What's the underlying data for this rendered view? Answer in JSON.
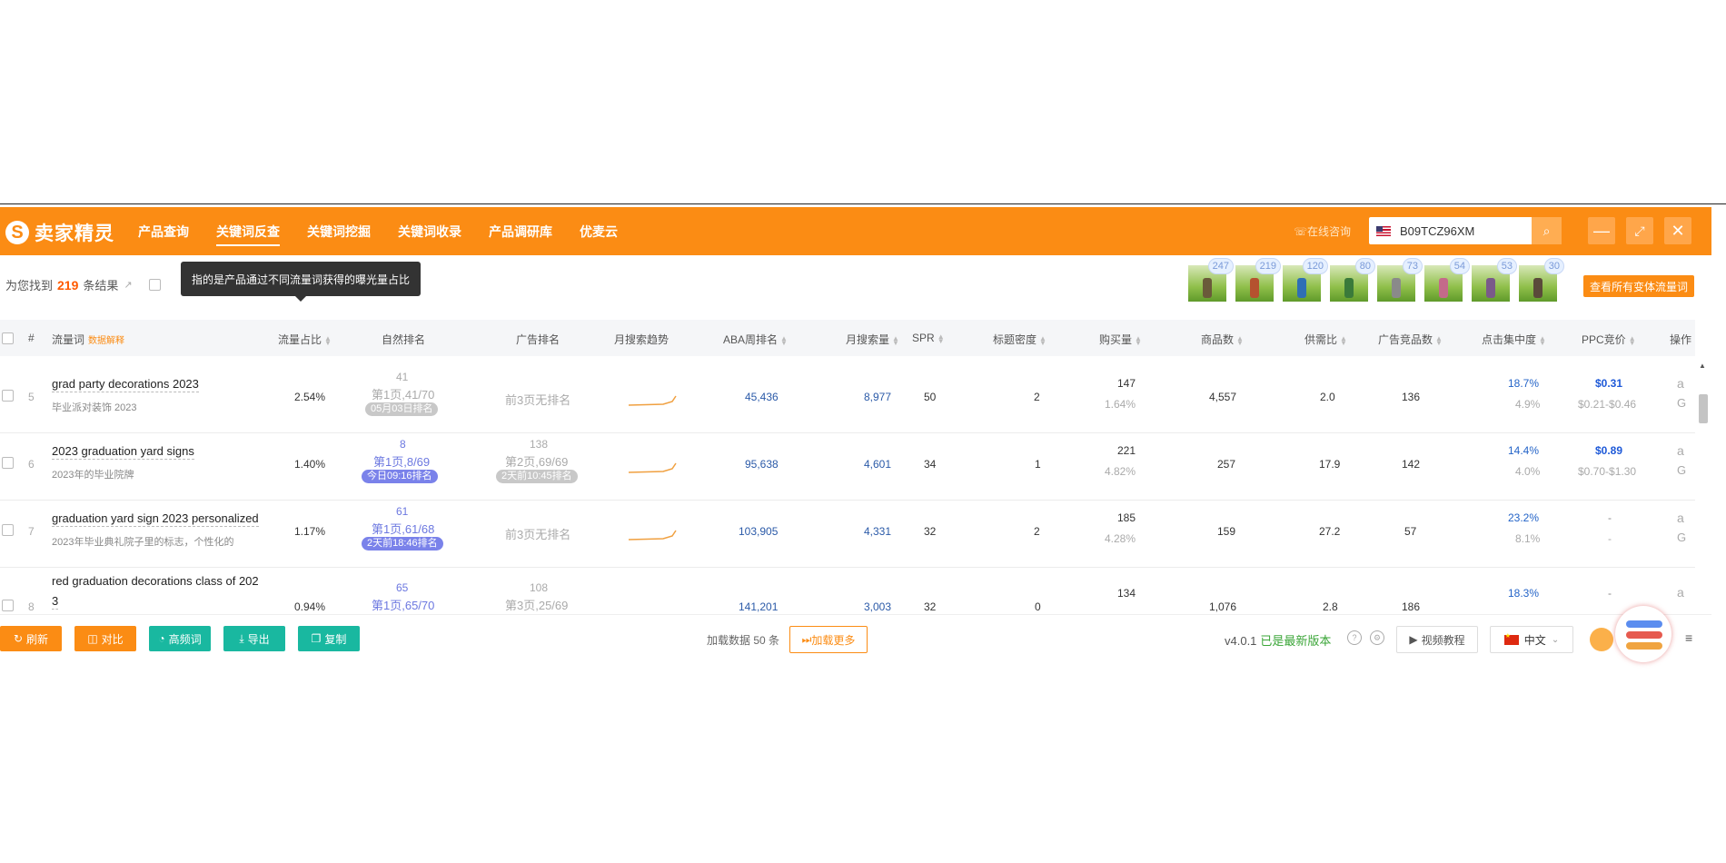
{
  "header": {
    "logo_text": "卖家精灵",
    "nav": [
      "产品查询",
      "关键词反查",
      "关键词挖掘",
      "关键词收录",
      "产品调研库",
      "优麦云"
    ],
    "active_nav_index": 1,
    "consult": "在线咨询",
    "asin_value": "B09TCZ96XM",
    "brand_color": "#fb8c14"
  },
  "summary": {
    "prefix": "为您找到",
    "count": "219",
    "suffix": "条结果",
    "tooltip": "指的是产品通过不同流量词获得的曝光量占比"
  },
  "variants": {
    "badges": [
      "247",
      "219",
      "120",
      "80",
      "73",
      "54",
      "53",
      "30"
    ],
    "button_label": "查看所有变体流量词"
  },
  "table": {
    "headers": {
      "index": "#",
      "keyword": "流量词",
      "keyword_link": "数据解释",
      "share": "流量占比",
      "organic": "自然排名",
      "ad": "广告排名",
      "trend": "月搜索趋势",
      "aba": "ABA周排名",
      "monthly": "月搜索量",
      "spr": "SPR",
      "title_density": "标题密度",
      "purchases": "购买量",
      "products": "商品数",
      "supply_demand": "供需比",
      "ad_products": "广告竞品数",
      "click_concentration": "点击集中度",
      "ppc": "PPC竞价",
      "actions": "操作"
    },
    "rows": [
      {
        "index": "5",
        "keyword": "grad party decorations 2023",
        "keyword_cn": "毕业派对装饰 2023",
        "share": "2.54%",
        "organic_top": "41",
        "organic_mid": "第1页,41/70",
        "organic_pill": "05月03日排名",
        "ad_text": "前3页无排名",
        "aba": "45,436",
        "monthly": "8,977",
        "spr": "50",
        "title_density": "2",
        "purchases": "147",
        "purchases_pct": "1.64%",
        "products": "4,557",
        "supply_demand": "2.0",
        "ad_products": "136",
        "click_concentration": "18.7%",
        "click_sub": "4.9%",
        "ppc": "$0.31",
        "ppc_range": "$0.21-$0.46"
      },
      {
        "index": "6",
        "keyword": "2023 graduation yard signs",
        "keyword_cn": "2023年的毕业院牌",
        "share": "1.40%",
        "organic_top": "8",
        "organic_mid": "第1页,8/69",
        "organic_pill": "今日09:16排名",
        "ad_top": "138",
        "ad_mid": "第2页,69/69",
        "ad_pill": "2天前10:45排名",
        "aba": "95,638",
        "monthly": "4,601",
        "spr": "34",
        "title_density": "1",
        "purchases": "221",
        "purchases_pct": "4.82%",
        "products": "257",
        "supply_demand": "17.9",
        "ad_products": "142",
        "click_concentration": "14.4%",
        "click_sub": "4.0%",
        "ppc": "$0.89",
        "ppc_range": "$0.70-$1.30"
      },
      {
        "index": "7",
        "keyword": "graduation yard sign 2023 personalized",
        "keyword_cn": "2023年毕业典礼院子里的标志，个性化的",
        "share": "1.17%",
        "organic_top": "61",
        "organic_mid": "第1页,61/68",
        "organic_pill": "2天前18:46排名",
        "ad_text": "前3页无排名",
        "aba": "103,905",
        "monthly": "4,331",
        "spr": "32",
        "title_density": "2",
        "purchases": "185",
        "purchases_pct": "4.28%",
        "products": "159",
        "supply_demand": "27.2",
        "ad_products": "57",
        "click_concentration": "23.2%",
        "click_sub": "8.1%",
        "ppc": "-",
        "ppc_range": "-"
      },
      {
        "index": "8",
        "keyword": "red graduation decorations class of 202",
        "keyword2": "3",
        "share": "0.94%",
        "organic_top": "65",
        "organic_mid": "第1页,65/70",
        "ad_top": "108",
        "ad_mid": "第3页,25/69",
        "aba": "141,201",
        "monthly": "3,003",
        "spr": "32",
        "title_density": "0",
        "purchases": "134",
        "products": "1,076",
        "supply_demand": "2.8",
        "ad_products": "186",
        "click_concentration": "18.3%",
        "ppc": "-"
      }
    ]
  },
  "footer": {
    "refresh": "刷新",
    "compare": "对比",
    "high_freq": "高频词",
    "export": "导出",
    "copy": "复制",
    "loaded": "加载数据 50 条",
    "load_more": "加载更多",
    "version": "v4.0.1",
    "version_status": "已是最新版本",
    "video": "视频教程",
    "language": "中文"
  }
}
